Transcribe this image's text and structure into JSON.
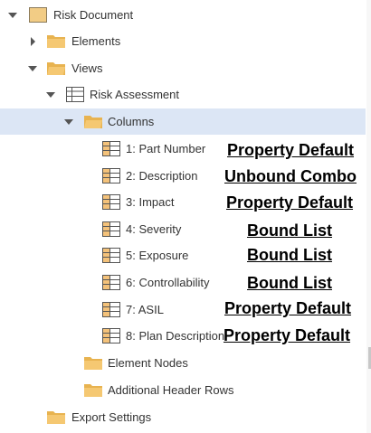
{
  "tree": {
    "nodes": [
      {
        "label": "Risk Document"
      },
      {
        "label": "Elements"
      },
      {
        "label": "Views"
      },
      {
        "label": "Risk Assessment"
      },
      {
        "label": "Columns"
      },
      {
        "label": "1: Part Number",
        "annotation": "Property Default"
      },
      {
        "label": "2: Description",
        "annotation": "Unbound Combo"
      },
      {
        "label": "3: Impact",
        "annotation": "Property Default"
      },
      {
        "label": "4: Severity",
        "annotation": "Bound List"
      },
      {
        "label": "5: Exposure",
        "annotation": "Bound List"
      },
      {
        "label": "6: Controllability",
        "annotation": "Bound List"
      },
      {
        "label": "7: ASIL",
        "annotation": "Property Default"
      },
      {
        "label": "8: Plan Description",
        "annotation": "Property Default"
      },
      {
        "label": "Element Nodes"
      },
      {
        "label": "Additional Header Rows"
      },
      {
        "label": "Export Settings"
      }
    ],
    "selected_node": "Columns"
  },
  "icons": {
    "expanded_toggle": "triangle-down-icon",
    "collapsed_toggle": "triangle-right-icon",
    "document": "document-icon",
    "folder": "folder-icon",
    "view": "table-icon",
    "column": "column-icon"
  },
  "colors": {
    "selection": "#dce6f5",
    "folder": "#f3c46e",
    "document": "#f2cc85",
    "text": "#333333",
    "annotation": "#000000"
  }
}
